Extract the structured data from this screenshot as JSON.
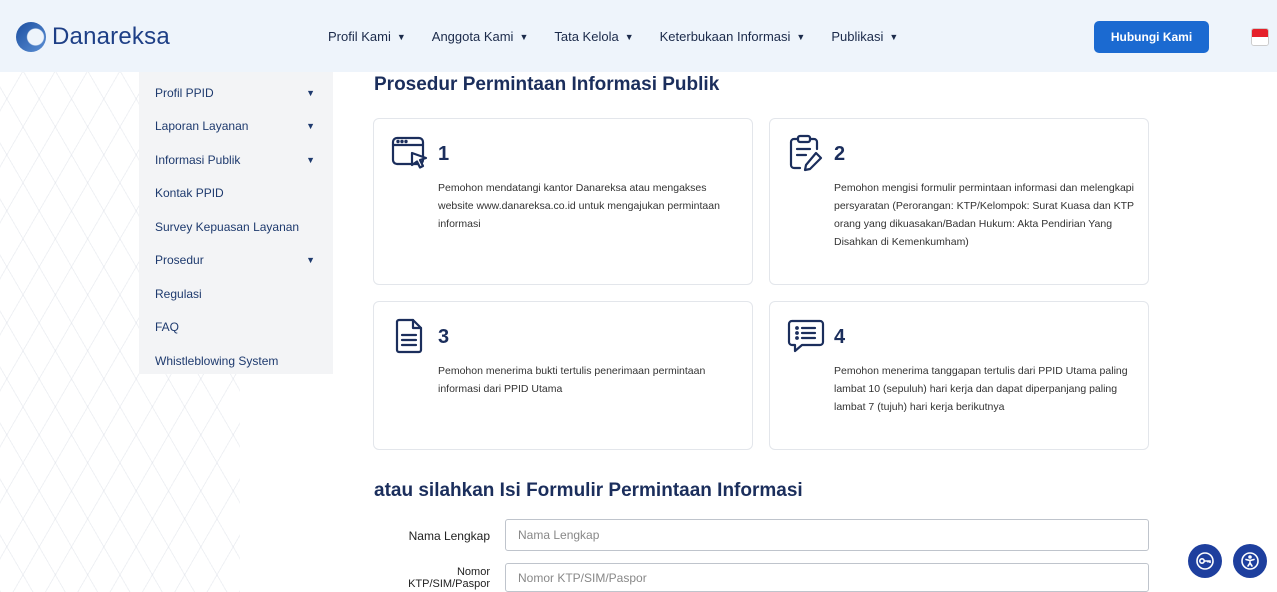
{
  "header": {
    "logo_text": "Danareksa",
    "nav": [
      {
        "label": "Profil Kami"
      },
      {
        "label": "Anggota Kami"
      },
      {
        "label": "Tata Kelola"
      },
      {
        "label": "Keterbukaan Informasi"
      },
      {
        "label": "Publikasi"
      }
    ],
    "contact_label": "Hubungi Kami",
    "flag_icon": "flag-indonesia-icon"
  },
  "sidebar": {
    "items": [
      {
        "label": "Profil PPID",
        "has_caret": true
      },
      {
        "label": "Laporan Layanan",
        "has_caret": true
      },
      {
        "label": "Informasi Publik",
        "has_caret": true
      },
      {
        "label": "Kontak PPID",
        "has_caret": false
      },
      {
        "label": "Survey Kepuasan Layanan",
        "has_caret": false
      },
      {
        "label": "Prosedur",
        "has_caret": true
      },
      {
        "label": "Regulasi",
        "has_caret": false
      },
      {
        "label": "FAQ",
        "has_caret": false
      },
      {
        "label": "Whistleblowing System",
        "has_caret": false
      }
    ]
  },
  "main": {
    "title": "Prosedur Permintaan Informasi Publik",
    "steps": [
      {
        "number": "1",
        "icon": "browser-cursor-icon",
        "text": "Pemohon mendatangi kantor Danareksa atau mengakses website www.danareksa.co.id untuk mengajukan permintaan informasi"
      },
      {
        "number": "2",
        "icon": "clipboard-edit-icon",
        "text": "Pemohon mengisi formulir permintaan informasi dan melengkapi persyaratan (Perorangan: KTP/Kelompok: Surat Kuasa dan KTP orang yang dikuasakan/Badan Hukum: Akta Pendirian Yang Disahkan di Kemenkumham)"
      },
      {
        "number": "3",
        "icon": "document-icon",
        "text": "Pemohon menerima bukti tertulis penerimaan permintaan informasi dari PPID Utama"
      },
      {
        "number": "4",
        "icon": "list-message-icon",
        "text": "Pemohon menerima tanggapan tertulis dari PPID Utama paling lambat 10 (sepuluh) hari kerja dan dapat diperpanjang paling lambat 7 (tujuh) hari kerja berikutnya"
      }
    ]
  },
  "form": {
    "title": "atau silahkan Isi Formulir Permintaan Informasi",
    "fields": [
      {
        "label": "Nama Lengkap",
        "placeholder": "Nama Lengkap",
        "value": ""
      },
      {
        "label_line1": "Nomor",
        "label_line2": "KTP/SIM/Paspor",
        "placeholder": "Nomor KTP/SIM/Paspor",
        "value": ""
      }
    ]
  },
  "floating": {
    "left_icon": "key-icon",
    "right_icon": "accessibility-icon"
  },
  "colors": {
    "header_bg": "#eef4fb",
    "primary": "#1b6ad1",
    "navy": "#1b2e5c",
    "float_bg": "#1e3f9e"
  }
}
